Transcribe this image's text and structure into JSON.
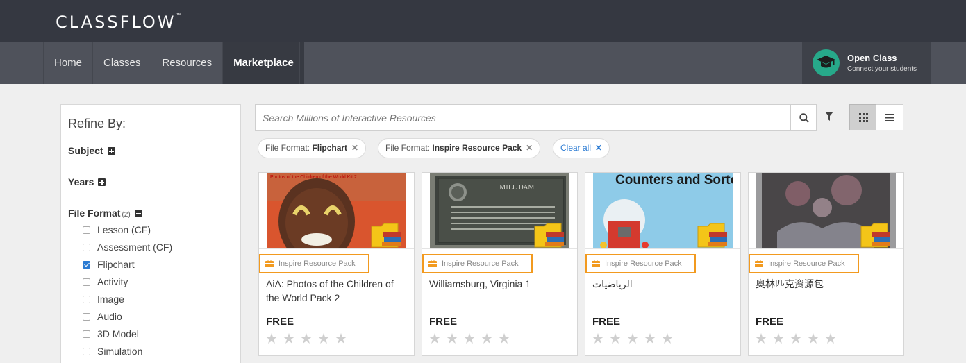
{
  "header": {
    "logo": "CLASSFLOW",
    "logo_tm": "™"
  },
  "nav": {
    "items": [
      {
        "label": "Home",
        "active": false
      },
      {
        "label": "Classes",
        "active": false
      },
      {
        "label": "Resources",
        "active": false
      },
      {
        "label": "Marketplace",
        "active": true
      }
    ]
  },
  "open_class": {
    "title": "Open Class",
    "subtitle": "Connect your students"
  },
  "sidebar": {
    "title": "Refine By:",
    "subject_label": "Subject",
    "years_label": "Years",
    "file_format_label": "File Format",
    "file_format_count": "(2)",
    "options": [
      {
        "label": "Lesson (CF)",
        "checked": false
      },
      {
        "label": "Assessment (CF)",
        "checked": false
      },
      {
        "label": "Flipchart",
        "checked": true
      },
      {
        "label": "Activity",
        "checked": false
      },
      {
        "label": "Image",
        "checked": false
      },
      {
        "label": "Audio",
        "checked": false
      },
      {
        "label": "3D Model",
        "checked": false
      },
      {
        "label": "Simulation",
        "checked": false
      }
    ]
  },
  "search": {
    "placeholder": "Search Millions of Interactive Resources",
    "value": ""
  },
  "filters": {
    "chip1_prefix": "File Format:",
    "chip1_value": "Flipchart",
    "chip2_prefix": "File Format:",
    "chip2_value": "Inspire Resource Pack",
    "clear_all": "Clear all"
  },
  "cards": [
    {
      "badge": "Inspire Resource Pack",
      "title": "AiA: Photos of the Children of the World Pack 2",
      "price": "FREE",
      "thumb_text": "Photos of the Children of the World Kit 2"
    },
    {
      "badge": "Inspire Resource Pack",
      "title": "Williamsburg, Virginia 1",
      "price": "FREE",
      "thumb_text": "MILL DAM"
    },
    {
      "badge": "Inspire Resource Pack",
      "title": "الرياضيات",
      "price": "FREE",
      "thumb_text": "Counters and Sorters"
    },
    {
      "badge": "Inspire Resource Pack",
      "title": "奥林匹克资源包",
      "price": "FREE",
      "thumb_text": ""
    }
  ],
  "colors": {
    "topbar": "#353841",
    "navbar": "#4f525b",
    "badge_border": "#f29a1f",
    "link": "#2b7bd3",
    "open_class_icon": "#27a98a"
  },
  "icons": [
    "search-icon",
    "filter-icon",
    "grid-view-icon",
    "list-view-icon",
    "graduation-cap-icon",
    "briefcase-icon",
    "star-icon",
    "folder-books-icon"
  ]
}
